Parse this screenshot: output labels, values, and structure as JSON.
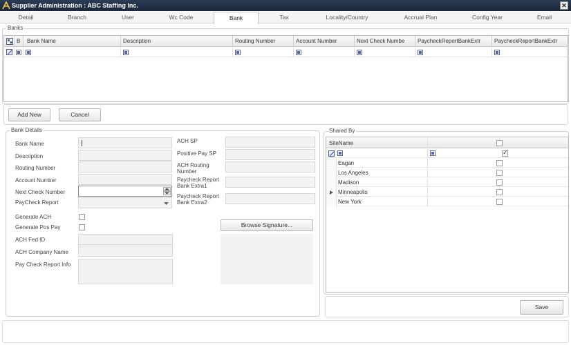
{
  "window": {
    "title": "Supplier Administration : ABC Staffing Inc.",
    "close_glyph": "✕"
  },
  "tabs": [
    {
      "label": "Detail"
    },
    {
      "label": "Branch"
    },
    {
      "label": "User"
    },
    {
      "label": "Wc Code"
    },
    {
      "label": "Bank"
    },
    {
      "label": "Tax"
    },
    {
      "label": "Locality/Country"
    },
    {
      "label": "Accrual Plan"
    },
    {
      "label": "Config Year"
    },
    {
      "label": "Email"
    }
  ],
  "banks": {
    "legend": "Banks",
    "columns": [
      {
        "label": "B"
      },
      {
        "label": "Bank Name"
      },
      {
        "label": "Description"
      },
      {
        "label": "Routing Number"
      },
      {
        "label": "Account Number"
      },
      {
        "label": "Next Check Numbe"
      },
      {
        "label": "PaycheckReportBankExtr"
      },
      {
        "label": "PaycheckReportBankExtr"
      }
    ]
  },
  "buttons": {
    "add_new": "Add New",
    "cancel": "Cancel",
    "browse_signature": "Browse Signature...",
    "save": "Save"
  },
  "bank_details": {
    "legend": "Bank Details",
    "bank_name": "Bank Name",
    "description": "Description",
    "routing_number": "Routing Number",
    "account_number": "Account Number",
    "next_check_number": "Next Check Number",
    "paycheck_report": "PayCheck Report",
    "generate_ach": "Generate ACH",
    "generate_pos_pay": "Generate Pos Pay",
    "ach_fed_id": "ACH Fed ID",
    "ach_company_name": "ACH Company Name",
    "pay_check_report_info": "Pay Check Report Info",
    "ach_sp": "ACH SP",
    "positive_pay_sp": "Positive Pay SP",
    "ach_routing_number": "ACH Routing Number",
    "paycheck_report_bank_extra1": "Paycheck Report Bank Extra1",
    "paycheck_report_bank_extra2": "Paycheck Report Bank Extra2"
  },
  "shared_by": {
    "legend": "Shared By",
    "column": "SiteName",
    "rows": [
      {
        "name": "Eagan",
        "checked": false
      },
      {
        "name": "Los Angeles",
        "checked": false
      },
      {
        "name": "Madison",
        "checked": false
      },
      {
        "name": "Minneapolis",
        "checked": false,
        "current": true
      },
      {
        "name": "New York",
        "checked": false
      }
    ]
  }
}
